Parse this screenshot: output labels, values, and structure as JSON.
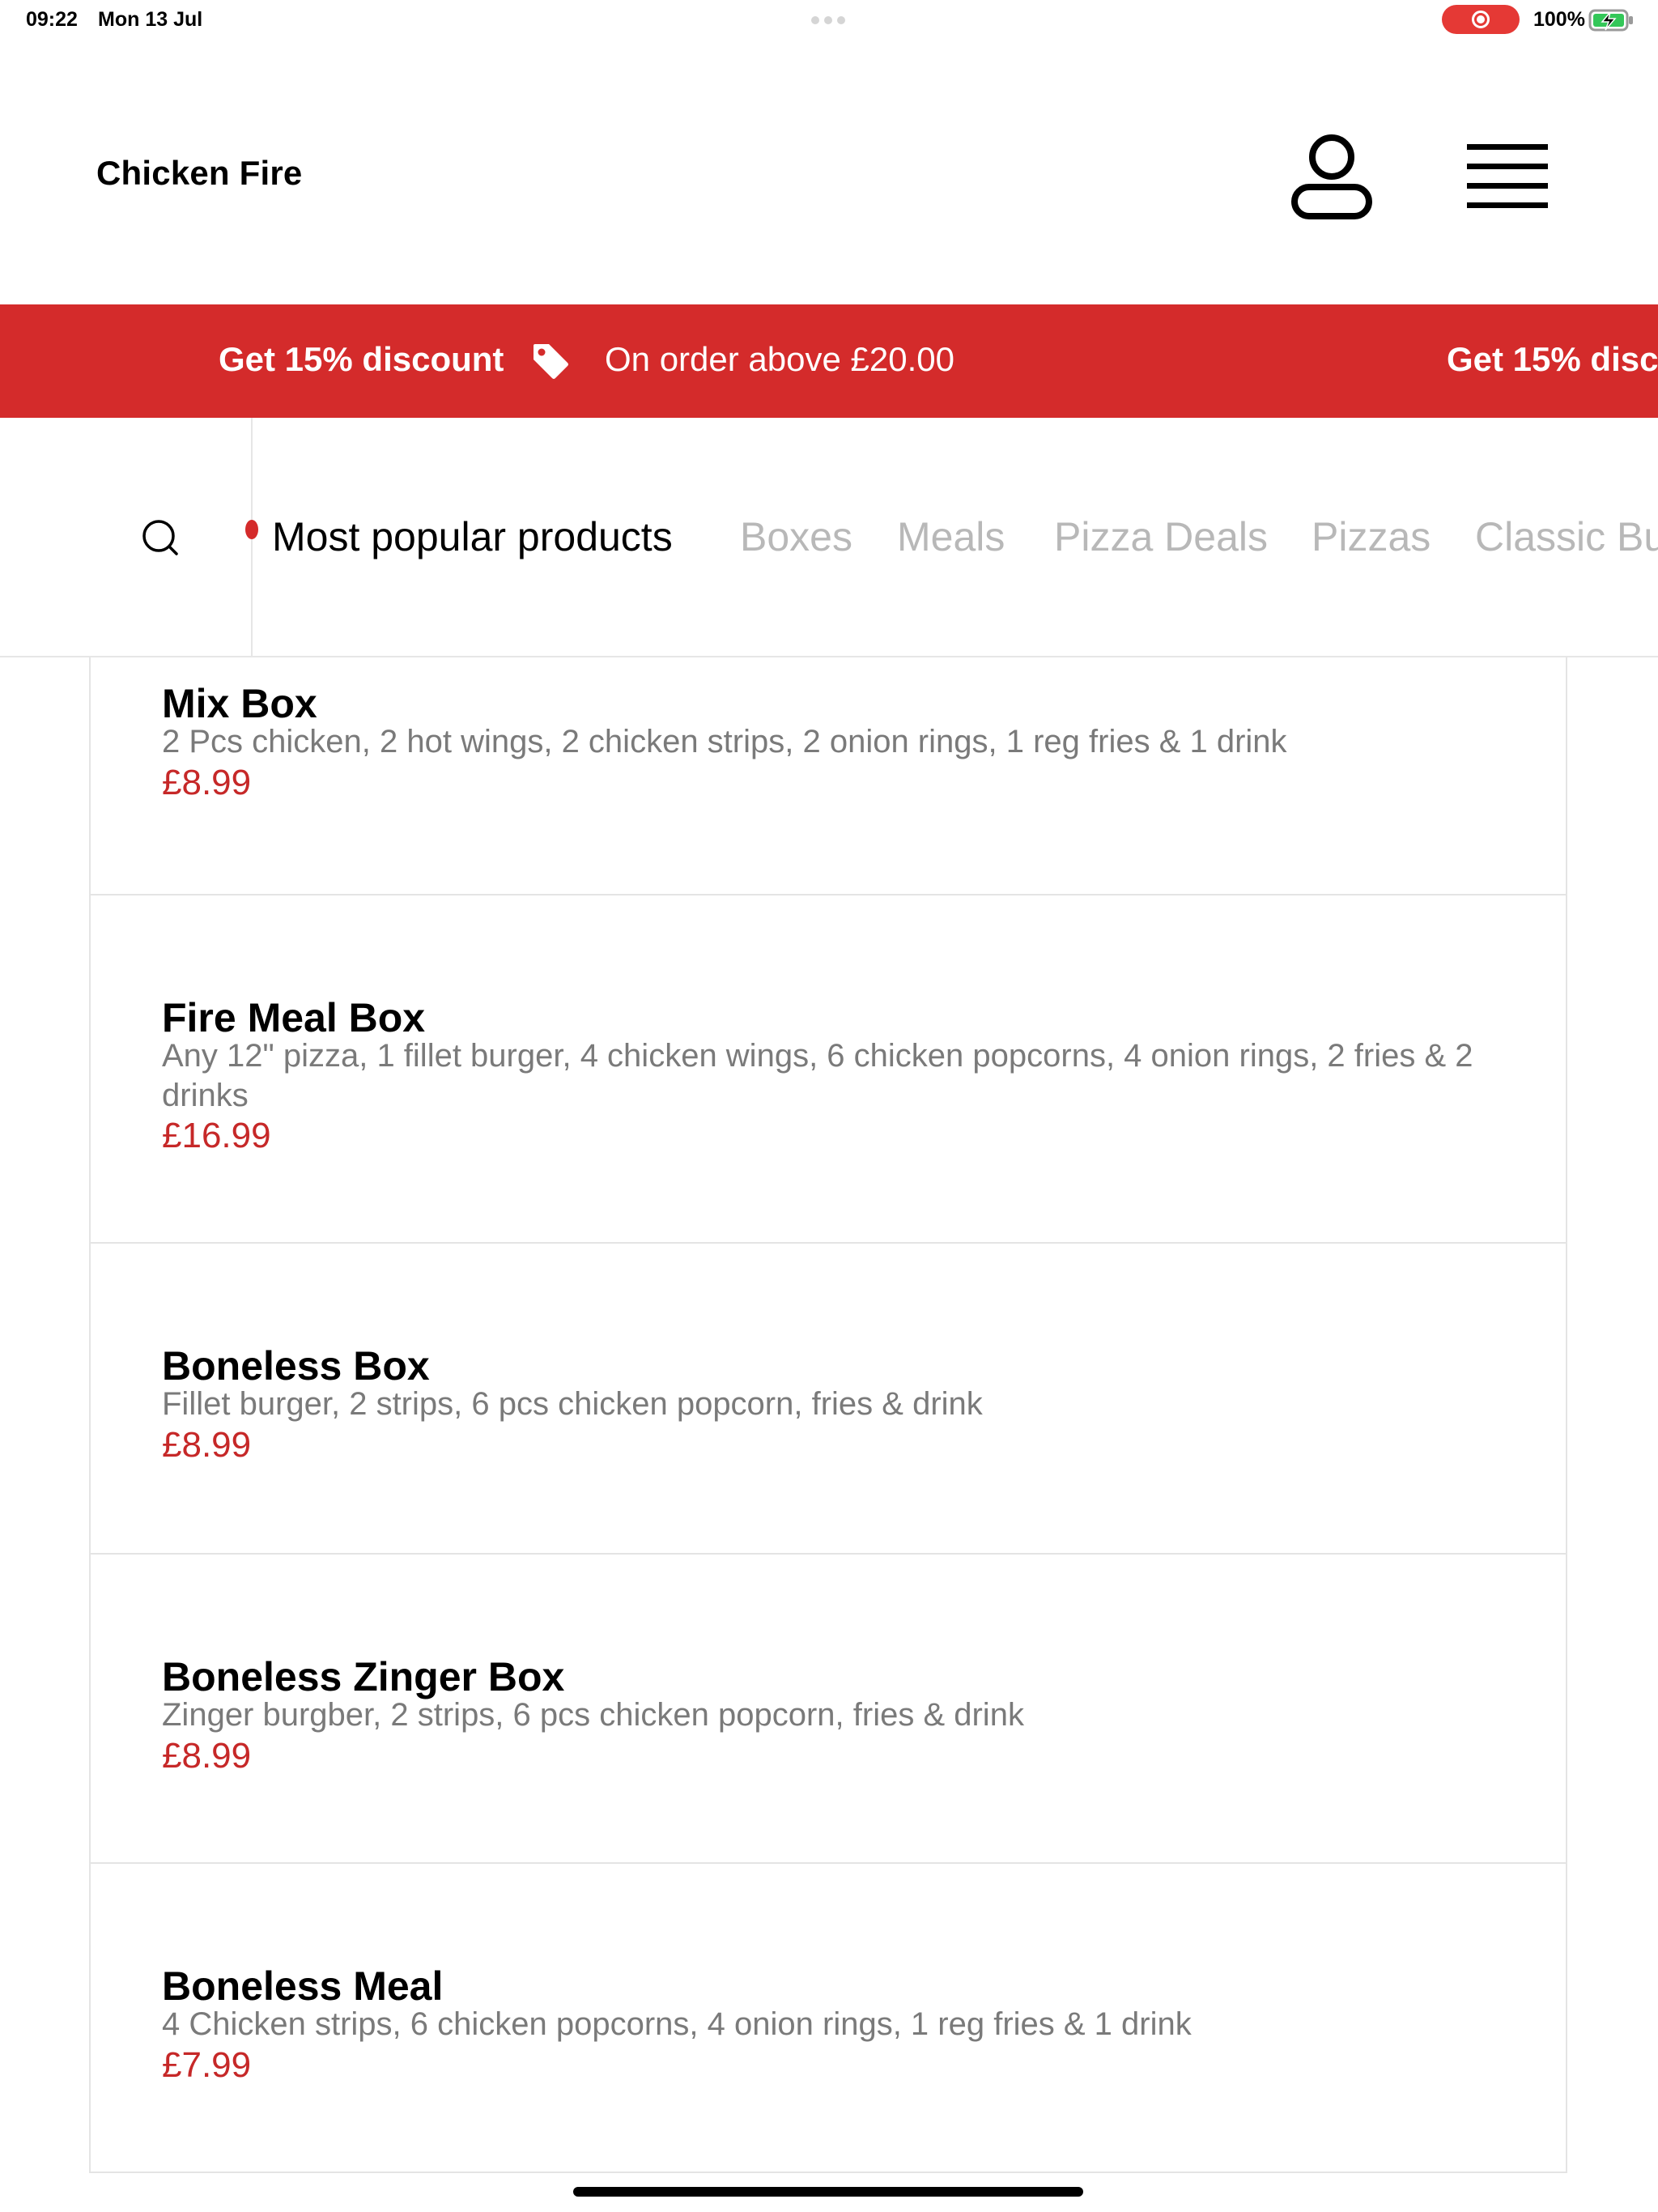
{
  "status_bar": {
    "time": "09:22",
    "date": "Mon 13 Jul",
    "battery": "100%",
    "record_color": "#e53935"
  },
  "header": {
    "brand": "Chicken Fire",
    "account_icon": "user-icon",
    "menu_icon": "hamburger-menu-icon"
  },
  "promo": {
    "headline": "Get 15% discount",
    "detail": "On order above £20.00",
    "headline_repeat": "Get 15% disco",
    "tag_icon": "price-tag-icon",
    "background": "#d42b2b"
  },
  "categories": {
    "search_icon": "search-icon",
    "tabs": [
      {
        "label": "Most popular products",
        "active": true
      },
      {
        "label": "Boxes",
        "active": false
      },
      {
        "label": "Meals",
        "active": false
      },
      {
        "label": "Pizza Deals",
        "active": false
      },
      {
        "label": "Pizzas",
        "active": false
      },
      {
        "label": "Classic Bu",
        "active": false
      }
    ]
  },
  "products": [
    {
      "name": "Mix Box",
      "description": "2 Pcs chicken, 2 hot wings, 2 chicken strips, 2 onion rings, 1 reg fries & 1 drink",
      "price": "£8.99"
    },
    {
      "name": "Fire Meal Box",
      "description": "Any 12\" pizza, 1 fillet burger, 4 chicken wings, 6 chicken popcorns, 4 onion rings, 2 fries & 2 drinks",
      "price": "£16.99"
    },
    {
      "name": "Boneless Box",
      "description": "Fillet burger, 2 strips, 6 pcs chicken popcorn, fries & drink",
      "price": "£8.99"
    },
    {
      "name": "Boneless Zinger Box",
      "description": "Zinger burgber, 2 strips, 6 pcs chicken popcorn, fries & drink",
      "price": "£8.99"
    },
    {
      "name": "Boneless Meal",
      "description": "4 Chicken strips, 6 chicken popcorns, 4 onion rings, 1 reg fries & 1 drink",
      "price": "£7.99"
    }
  ],
  "colors": {
    "price": "#c62828",
    "inactive_tab": "#b8b8b8"
  }
}
